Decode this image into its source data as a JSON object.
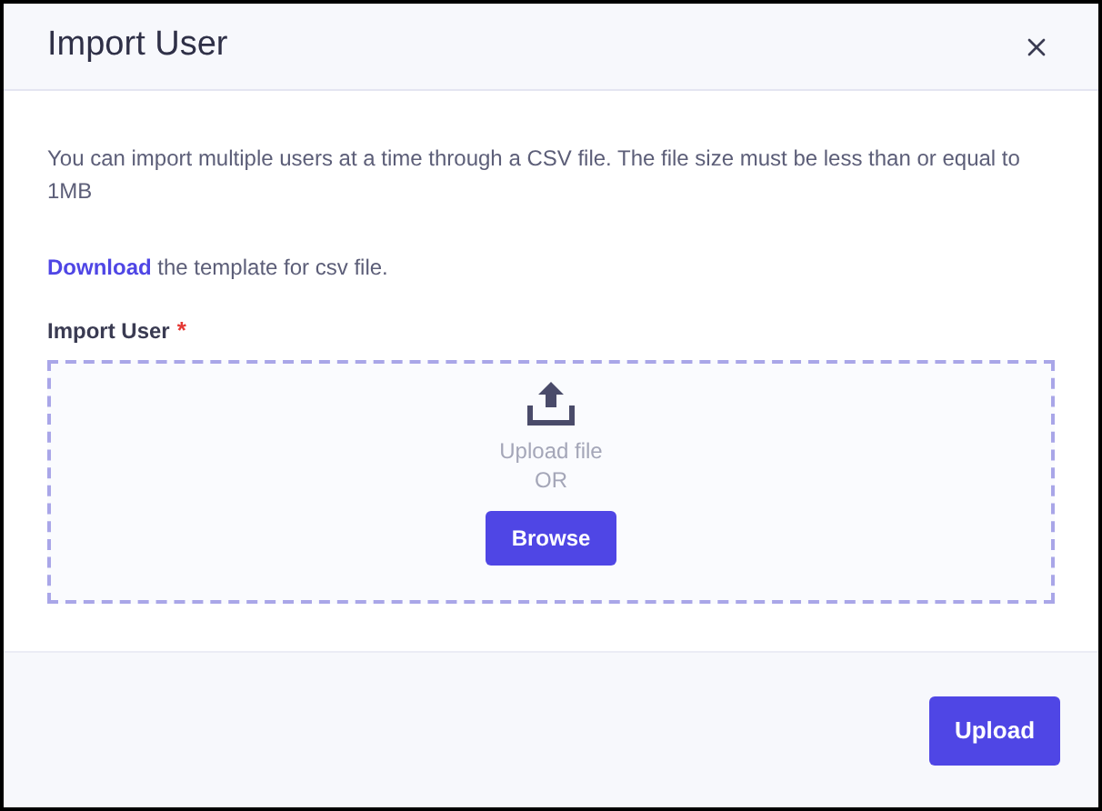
{
  "dialog": {
    "title": "Import User"
  },
  "description": "You can import multiple users at a time through a CSV file. The file size must be less than or equal to 1MB",
  "template_note": {
    "link": "Download",
    "text": " the template for csv file."
  },
  "field": {
    "label": "Import User",
    "required": true,
    "required_mark": "*"
  },
  "dropzone": {
    "prompt": "Upload file",
    "separator": "OR",
    "button": "Browse"
  },
  "footer": {
    "buttons": [
      "Upload"
    ]
  }
}
